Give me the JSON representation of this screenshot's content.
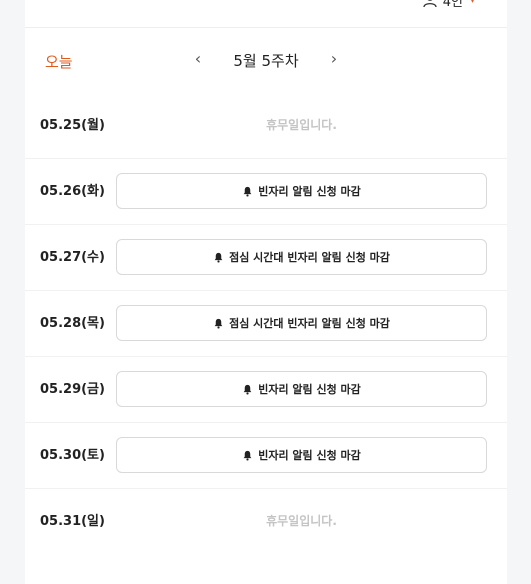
{
  "header": {
    "party_size": "4인"
  },
  "week_nav": {
    "today_label": "오늘",
    "prev_symbol": "‹",
    "week_label": "5월 5주차",
    "next_symbol": "›"
  },
  "days": [
    {
      "date": "05.25(월)",
      "status": "휴무일입니다."
    },
    {
      "date": "05.26(화)",
      "button": "빈자리 알림 신청 마감"
    },
    {
      "date": "05.27(수)",
      "button": "점심 시간대 빈자리 알림 신청 마감"
    },
    {
      "date": "05.28(목)",
      "button": "점심 시간대 빈자리 알림 신청 마감"
    },
    {
      "date": "05.29(금)",
      "button": "빈자리 알림 신청 마감"
    },
    {
      "date": "05.30(토)",
      "button": "빈자리 알림 신청 마감"
    },
    {
      "date": "05.31(일)",
      "status": "휴무일입니다."
    }
  ],
  "colors": {
    "accent": "#e05a1c",
    "holiday_text": "#c4c4c4"
  },
  "icons": {
    "party": "person-icon",
    "alert": "bell-icon",
    "dropdown": "chevron-down-icon"
  }
}
